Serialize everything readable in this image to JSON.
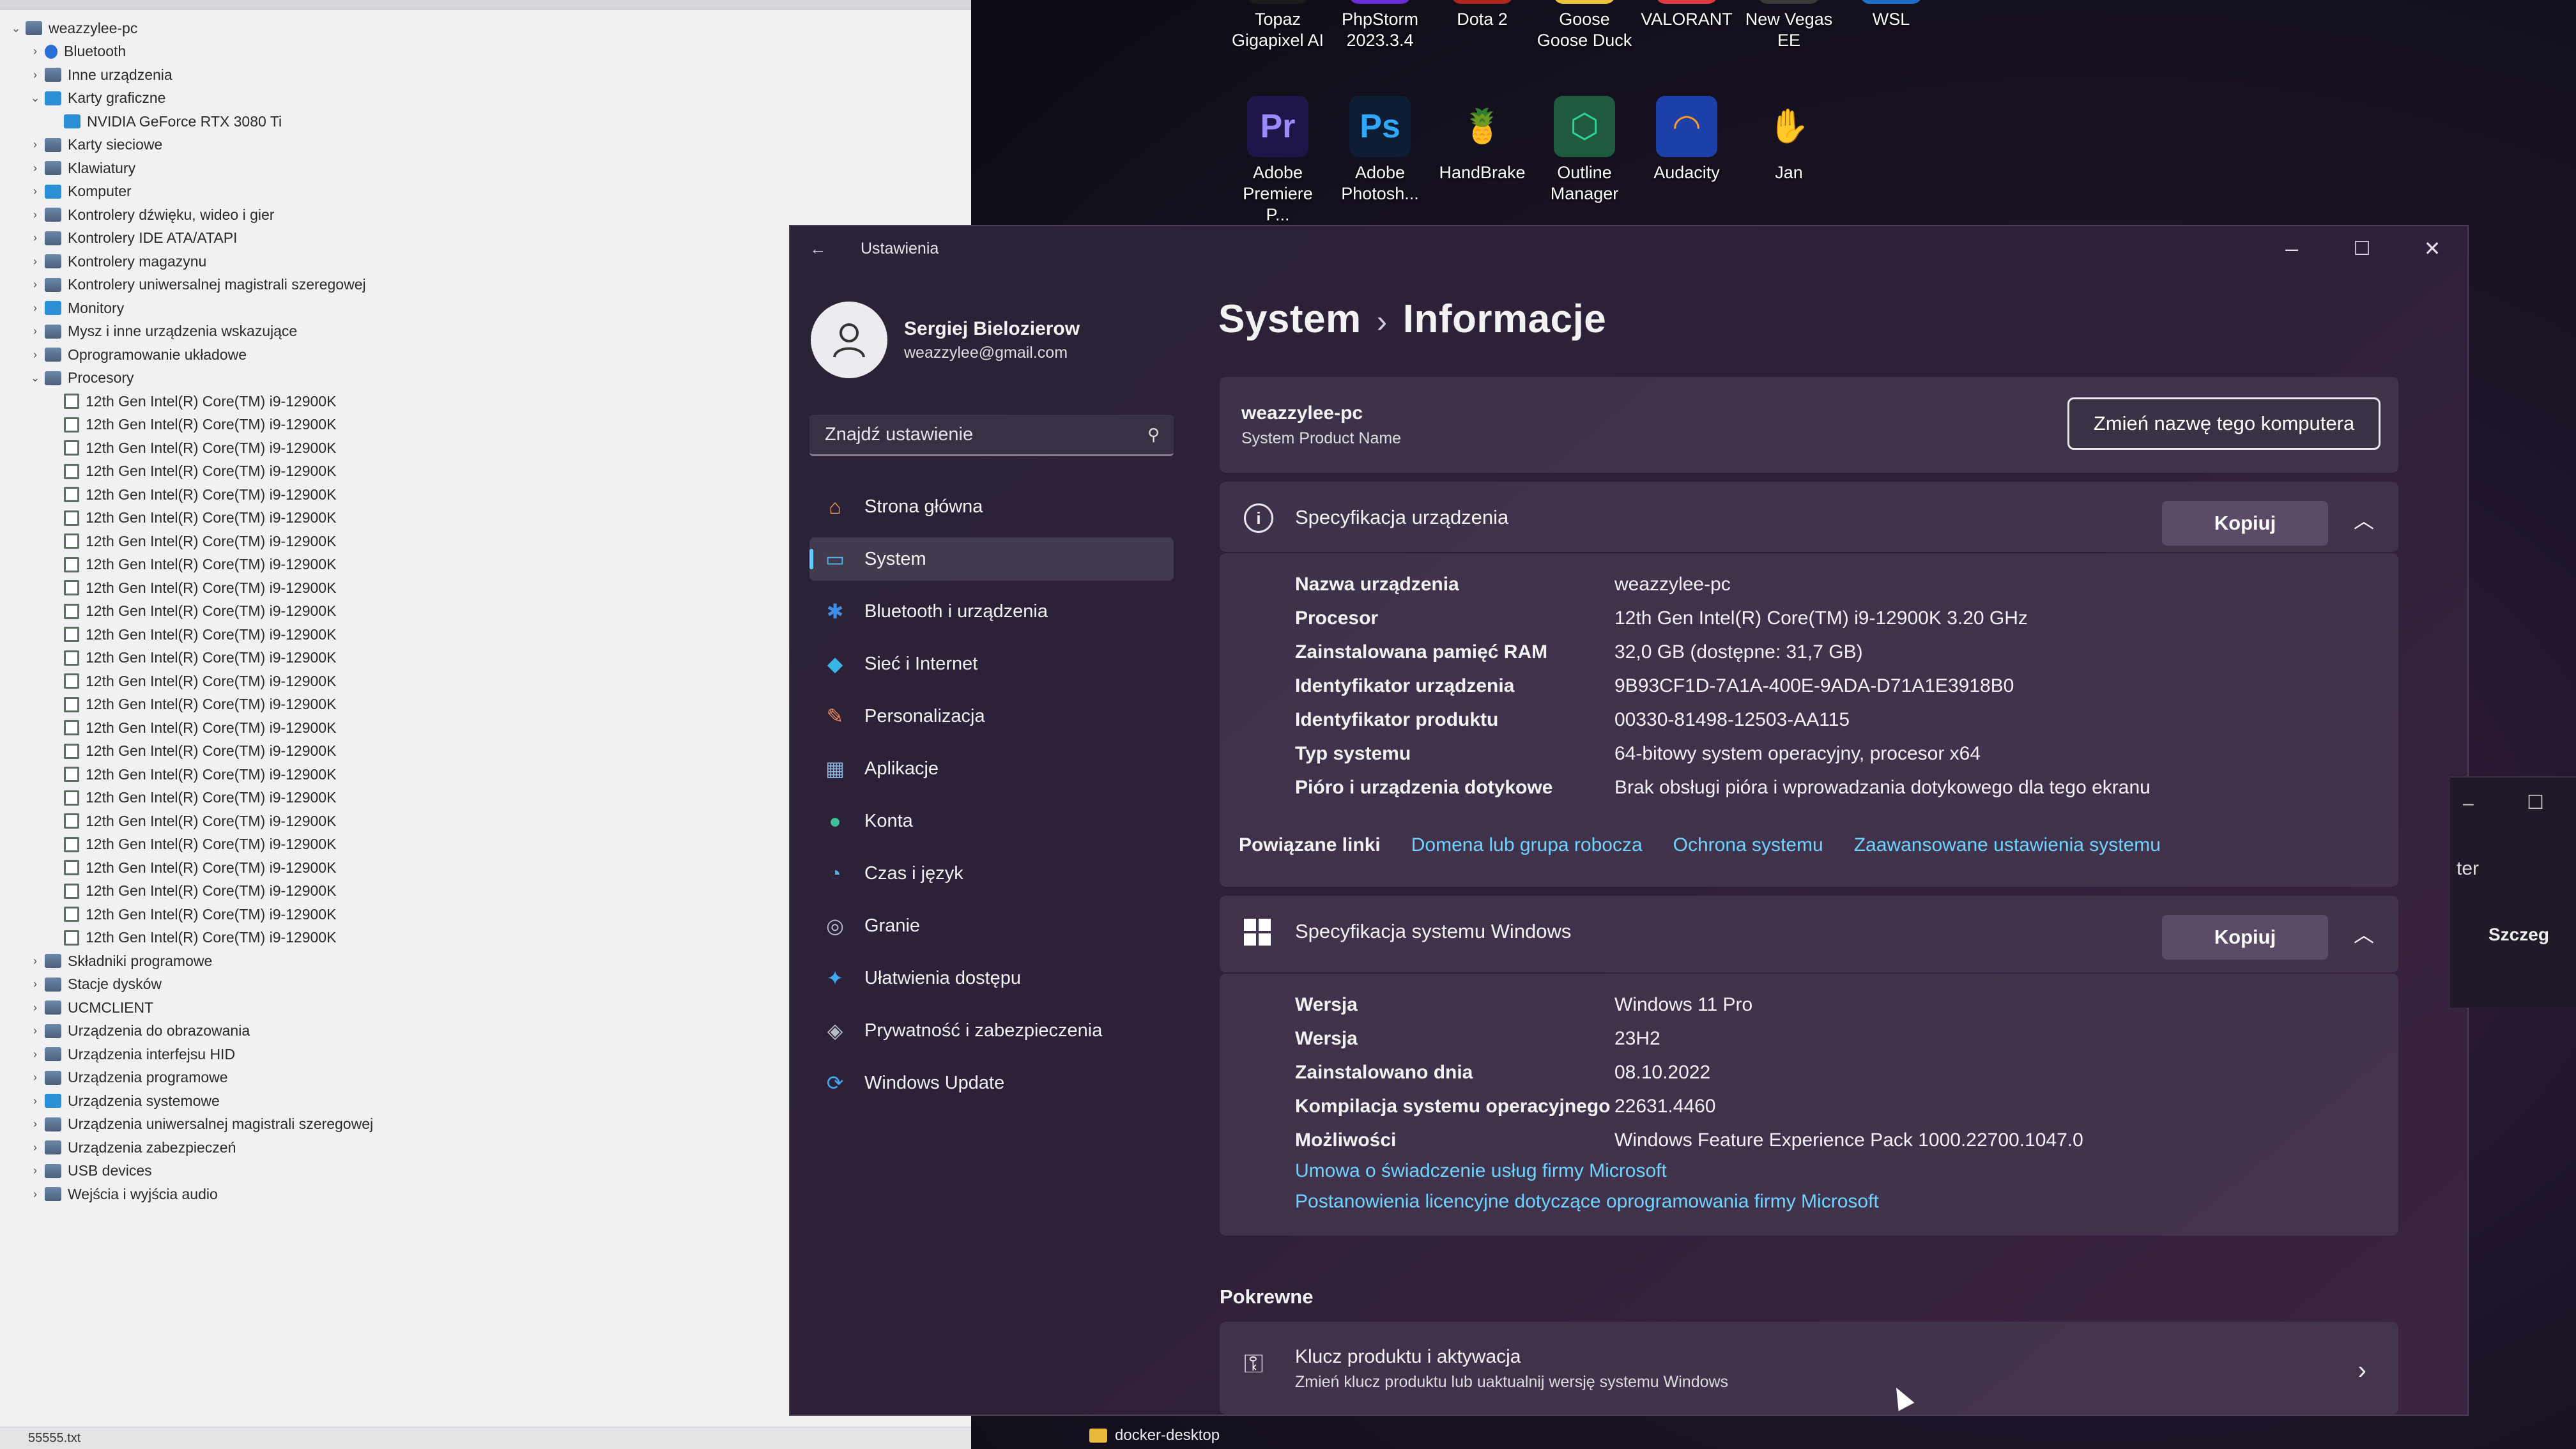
{
  "device_manager": {
    "tree": [
      {
        "label": "weazzylee-pc",
        "level": 0,
        "chev": "⌄",
        "icon": "computer"
      },
      {
        "label": "Bluetooth",
        "level": 1,
        "chev": "›",
        "icon": "bt"
      },
      {
        "label": "Inne urządzenia",
        "level": 1,
        "chev": "›",
        "icon": "dev"
      },
      {
        "label": "Karty graficzne",
        "level": 1,
        "chev": "⌄",
        "icon": "disp"
      },
      {
        "label": "NVIDIA GeForce RTX 3080 Ti",
        "level": 2,
        "chev": "",
        "icon": "disp"
      },
      {
        "label": "Karty sieciowe",
        "level": 1,
        "chev": "›",
        "icon": "dev"
      },
      {
        "label": "Klawiatury",
        "level": 1,
        "chev": "›",
        "icon": "dev"
      },
      {
        "label": "Komputer",
        "level": 1,
        "chev": "›",
        "icon": "disp"
      },
      {
        "label": "Kontrolery dźwięku, wideo i gier",
        "level": 1,
        "chev": "›",
        "icon": "dev"
      },
      {
        "label": "Kontrolery IDE ATA/ATAPI",
        "level": 1,
        "chev": "›",
        "icon": "dev"
      },
      {
        "label": "Kontrolery magazynu",
        "level": 1,
        "chev": "›",
        "icon": "dev"
      },
      {
        "label": "Kontrolery uniwersalnej magistrali szeregowej",
        "level": 1,
        "chev": "›",
        "icon": "dev"
      },
      {
        "label": "Monitory",
        "level": 1,
        "chev": "›",
        "icon": "disp"
      },
      {
        "label": "Mysz i inne urządzenia wskazujące",
        "level": 1,
        "chev": "›",
        "icon": "dev"
      },
      {
        "label": "Oprogramowanie układowe",
        "level": 1,
        "chev": "›",
        "icon": "dev"
      },
      {
        "label": "Procesory",
        "level": 1,
        "chev": "⌄",
        "icon": "dev"
      },
      {
        "label": "12th Gen Intel(R) Core(TM) i9-12900K",
        "level": 2,
        "chev": "",
        "icon": "cpu"
      },
      {
        "label": "12th Gen Intel(R) Core(TM) i9-12900K",
        "level": 2,
        "chev": "",
        "icon": "cpu"
      },
      {
        "label": "12th Gen Intel(R) Core(TM) i9-12900K",
        "level": 2,
        "chev": "",
        "icon": "cpu"
      },
      {
        "label": "12th Gen Intel(R) Core(TM) i9-12900K",
        "level": 2,
        "chev": "",
        "icon": "cpu"
      },
      {
        "label": "12th Gen Intel(R) Core(TM) i9-12900K",
        "level": 2,
        "chev": "",
        "icon": "cpu"
      },
      {
        "label": "12th Gen Intel(R) Core(TM) i9-12900K",
        "level": 2,
        "chev": "",
        "icon": "cpu"
      },
      {
        "label": "12th Gen Intel(R) Core(TM) i9-12900K",
        "level": 2,
        "chev": "",
        "icon": "cpu"
      },
      {
        "label": "12th Gen Intel(R) Core(TM) i9-12900K",
        "level": 2,
        "chev": "",
        "icon": "cpu"
      },
      {
        "label": "12th Gen Intel(R) Core(TM) i9-12900K",
        "level": 2,
        "chev": "",
        "icon": "cpu"
      },
      {
        "label": "12th Gen Intel(R) Core(TM) i9-12900K",
        "level": 2,
        "chev": "",
        "icon": "cpu"
      },
      {
        "label": "12th Gen Intel(R) Core(TM) i9-12900K",
        "level": 2,
        "chev": "",
        "icon": "cpu"
      },
      {
        "label": "12th Gen Intel(R) Core(TM) i9-12900K",
        "level": 2,
        "chev": "",
        "icon": "cpu"
      },
      {
        "label": "12th Gen Intel(R) Core(TM) i9-12900K",
        "level": 2,
        "chev": "",
        "icon": "cpu"
      },
      {
        "label": "12th Gen Intel(R) Core(TM) i9-12900K",
        "level": 2,
        "chev": "",
        "icon": "cpu"
      },
      {
        "label": "12th Gen Intel(R) Core(TM) i9-12900K",
        "level": 2,
        "chev": "",
        "icon": "cpu"
      },
      {
        "label": "12th Gen Intel(R) Core(TM) i9-12900K",
        "level": 2,
        "chev": "",
        "icon": "cpu"
      },
      {
        "label": "12th Gen Intel(R) Core(TM) i9-12900K",
        "level": 2,
        "chev": "",
        "icon": "cpu"
      },
      {
        "label": "12th Gen Intel(R) Core(TM) i9-12900K",
        "level": 2,
        "chev": "",
        "icon": "cpu"
      },
      {
        "label": "12th Gen Intel(R) Core(TM) i9-12900K",
        "level": 2,
        "chev": "",
        "icon": "cpu"
      },
      {
        "label": "12th Gen Intel(R) Core(TM) i9-12900K",
        "level": 2,
        "chev": "",
        "icon": "cpu"
      },
      {
        "label": "12th Gen Intel(R) Core(TM) i9-12900K",
        "level": 2,
        "chev": "",
        "icon": "cpu"
      },
      {
        "label": "12th Gen Intel(R) Core(TM) i9-12900K",
        "level": 2,
        "chev": "",
        "icon": "cpu"
      },
      {
        "label": "12th Gen Intel(R) Core(TM) i9-12900K",
        "level": 2,
        "chev": "",
        "icon": "cpu"
      },
      {
        "label": "12th Gen Intel(R) Core(TM) i9-12900K",
        "level": 2,
        "chev": "",
        "icon": "cpu"
      },
      {
        "label": "Składniki programowe",
        "level": 1,
        "chev": "›",
        "icon": "dev"
      },
      {
        "label": "Stacje dysków",
        "level": 1,
        "chev": "›",
        "icon": "dev"
      },
      {
        "label": "UCMCLIENT",
        "level": 1,
        "chev": "›",
        "icon": "dev"
      },
      {
        "label": "Urządzenia do obrazowania",
        "level": 1,
        "chev": "›",
        "icon": "dev"
      },
      {
        "label": "Urządzenia interfejsu HID",
        "level": 1,
        "chev": "›",
        "icon": "dev"
      },
      {
        "label": "Urządzenia programowe",
        "level": 1,
        "chev": "›",
        "icon": "dev"
      },
      {
        "label": "Urządzenia systemowe",
        "level": 1,
        "chev": "›",
        "icon": "disp"
      },
      {
        "label": "Urządzenia uniwersalnej magistrali szeregowej",
        "level": 1,
        "chev": "›",
        "icon": "dev"
      },
      {
        "label": "Urządzenia zabezpieczeń",
        "level": 1,
        "chev": "›",
        "icon": "dev"
      },
      {
        "label": "USB devices",
        "level": 1,
        "chev": "›",
        "icon": "dev"
      },
      {
        "label": "Wejścia i wyjścia audio",
        "level": 1,
        "chev": "›",
        "icon": "dev"
      }
    ],
    "status_text": "55555.txt"
  },
  "desktop": {
    "icons": [
      {
        "label": "Topaz Gigapixel AI",
        "glyph": "◉",
        "color": "#1b1b1b",
        "fg": "#e0483a"
      },
      {
        "label": "PhpStorm 2023.3.4",
        "glyph": "PS",
        "color": "#6b2bd6",
        "fg": "#fff"
      },
      {
        "label": "Dota 2",
        "glyph": "◆",
        "color": "#b0261c",
        "fg": "#fff"
      },
      {
        "label": "Goose Goose Duck",
        "glyph": "◒",
        "color": "#e8c23a",
        "fg": "#222"
      },
      {
        "label": "VALORANT",
        "glyph": "V",
        "color": "#e23b45",
        "fg": "#fff"
      },
      {
        "label": "New Vegas EE",
        "glyph": "☢",
        "color": "#3a3a3a",
        "fg": "#e8c23a"
      },
      {
        "label": "WSL",
        "glyph": "▲",
        "color": "#1e6fc8",
        "fg": "#fff"
      },
      {
        "label": "Adobe Premiere P...",
        "glyph": "Pr",
        "color": "#1f1548",
        "fg": "#9a8bff"
      },
      {
        "label": "Adobe Photosh...",
        "glyph": "Ps",
        "color": "#0d1d33",
        "fg": "#31a8ff"
      },
      {
        "label": "HandBrake",
        "glyph": "🍍",
        "color": "transparent",
        "fg": "#e0a020"
      },
      {
        "label": "Outline Manager",
        "glyph": "⬡",
        "color": "#1f5a3e",
        "fg": "#2fd39a"
      },
      {
        "label": "Audacity",
        "glyph": "◠",
        "color": "#1d3fa8",
        "fg": "#ff9a2a"
      },
      {
        "label": "Jan",
        "glyph": "✋",
        "color": "transparent",
        "fg": "#ffd54a"
      }
    ]
  },
  "settings": {
    "app_title": "Ustawienia",
    "window_controls": {
      "minimize": "–",
      "maximize": "☐",
      "close": "✕"
    },
    "profile": {
      "name": "Sergiej Bielozierow",
      "email": "weazzylee@gmail.com"
    },
    "search": {
      "placeholder": "Znajdź ustawienie"
    },
    "nav": [
      {
        "label": "Strona główna",
        "icon": "home-icon",
        "glyph": "⌂",
        "color": "#f0a35a"
      },
      {
        "label": "System",
        "icon": "system-icon",
        "glyph": "▭",
        "color": "#49b6f5",
        "active": true
      },
      {
        "label": "Bluetooth i urządzenia",
        "icon": "bluetooth-icon",
        "glyph": "✱",
        "color": "#3d8fe8"
      },
      {
        "label": "Sieć i Internet",
        "icon": "wifi-icon",
        "glyph": "◆",
        "color": "#38b6e8"
      },
      {
        "label": "Personalizacja",
        "icon": "brush-icon",
        "glyph": "✎",
        "color": "#f08a5a"
      },
      {
        "label": "Aplikacje",
        "icon": "apps-icon",
        "glyph": "▦",
        "color": "#8ab0d8"
      },
      {
        "label": "Konta",
        "icon": "account-icon",
        "glyph": "●",
        "color": "#3fbf9a"
      },
      {
        "label": "Czas i język",
        "icon": "clock-globe-icon",
        "glyph": "◔",
        "color": "#5ab0e8"
      },
      {
        "label": "Granie",
        "icon": "gamepad-icon",
        "glyph": "◎",
        "color": "#b9bcc8"
      },
      {
        "label": "Ułatwienia dostępu",
        "icon": "accessibility-icon",
        "glyph": "✦",
        "color": "#3fa8f0"
      },
      {
        "label": "Prywatność i zabezpieczenia",
        "icon": "shield-icon",
        "glyph": "◈",
        "color": "#b8bcc6"
      },
      {
        "label": "Windows Update",
        "icon": "update-icon",
        "glyph": "⟳",
        "color": "#3fa8f0"
      }
    ],
    "breadcrumb": {
      "parent": "System",
      "sep": "›",
      "current": "Informacje"
    },
    "pc": {
      "name": "weazzylee-pc",
      "subtitle": "System Product Name",
      "rename_label": "Zmień nazwę tego komputera"
    },
    "device_spec": {
      "title": "Specyfikacja urządzenia",
      "copy_label": "Kopiuj",
      "rows": [
        {
          "k": "Nazwa urządzenia",
          "v": "weazzylee-pc"
        },
        {
          "k": "Procesor",
          "v": "12th Gen Intel(R) Core(TM) i9-12900K   3.20 GHz"
        },
        {
          "k": "Zainstalowana pamięć RAM",
          "v": "32,0 GB (dostępne: 31,7 GB)"
        },
        {
          "k": "Identyfikator urządzenia",
          "v": "9B93CF1D-7A1A-400E-9ADA-D71A1E3918B0"
        },
        {
          "k": "Identyfikator produktu",
          "v": "00330-81498-12503-AA115"
        },
        {
          "k": "Typ systemu",
          "v": "64-bitowy system operacyjny, procesor x64"
        },
        {
          "k": "Pióro i urządzenia dotykowe",
          "v": "Brak obsługi pióra i wprowadzania dotykowego dla tego ekranu"
        }
      ],
      "related_links_label": "Powiązane linki",
      "links": [
        "Domena lub grupa robocza",
        "Ochrona systemu",
        "Zaawansowane ustawienia systemu"
      ]
    },
    "windows_spec": {
      "title": "Specyfikacja systemu Windows",
      "copy_label": "Kopiuj",
      "rows": [
        {
          "k": "Wersja",
          "v": "Windows 11 Pro"
        },
        {
          "k": "Wersja",
          "v": "23H2"
        },
        {
          "k": "Zainstalowano dnia",
          "v": "08.10.2022"
        },
        {
          "k": "Kompilacja systemu operacyjnego",
          "v": "22631.4460"
        },
        {
          "k": "Możliwości",
          "v": "Windows Feature Experience Pack 1000.22700.1047.0"
        }
      ],
      "link1": "Umowa o świadczenie usług firmy Microsoft",
      "link2": "Postanowienia licencyjne dotyczące oprogramowania firmy Microsoft"
    },
    "related": {
      "title": "Pokrewne",
      "key_title": "Klucz produktu i aktywacja",
      "key_sub": "Zmień klucz produktu lub uaktualnij wersję systemu Windows"
    }
  },
  "right_window": {
    "text1": "ter",
    "text2": "Szczeg"
  },
  "taskbar": {
    "item": "docker-desktop"
  }
}
